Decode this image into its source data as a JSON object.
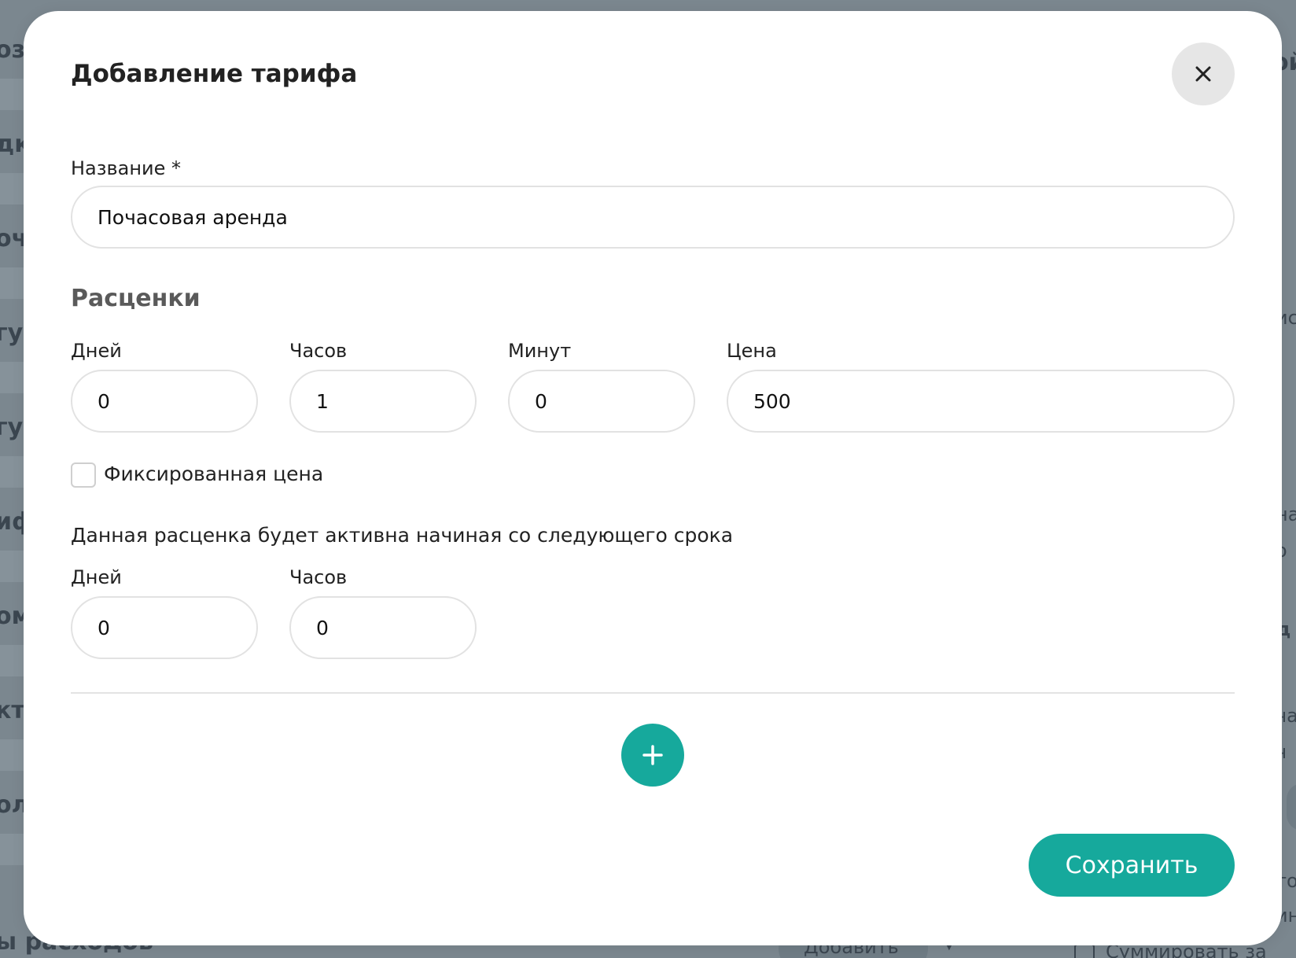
{
  "background": {
    "left_fragments": [
      "оз",
      "дк",
      "оч",
      "гу",
      "гу",
      "иф",
      "ом",
      "кт",
      "ол"
    ],
    "bottom_fragment": "ы расходов",
    "bottom_dropdown": "Добавить",
    "bottom_right_fragment": "Суммировать за",
    "right_fragments": [
      "ой",
      "ис",
      "на",
      "о",
      "д",
      "ча",
      "ч",
      "то",
      "ин"
    ]
  },
  "modal": {
    "title": "Добавление тарифа",
    "name_label": "Название *",
    "name_value": "Почасовая аренда",
    "section_title": "Расценки",
    "rate": {
      "days_label": "Дней",
      "days_value": "0",
      "hours_label": "Часов",
      "hours_value": "1",
      "minutes_label": "Минут",
      "minutes_value": "0",
      "price_label": "Цена",
      "price_value": "500"
    },
    "fixed_price_label": "Фиксированная цена",
    "fixed_price_checked": false,
    "active_note": "Данная расценка будет активна начиная со следующего срока",
    "active_from": {
      "days_label": "Дней",
      "days_value": "0",
      "hours_label": "Часов",
      "hours_value": "0"
    },
    "save_label": "Сохранить"
  },
  "colors": {
    "accent": "#16a99c",
    "overlay": "#7b878f",
    "close_bg": "#e6e6e6"
  },
  "icons": {
    "close": "close-icon",
    "add": "plus-icon",
    "dropdown": "chevron-down-icon"
  }
}
